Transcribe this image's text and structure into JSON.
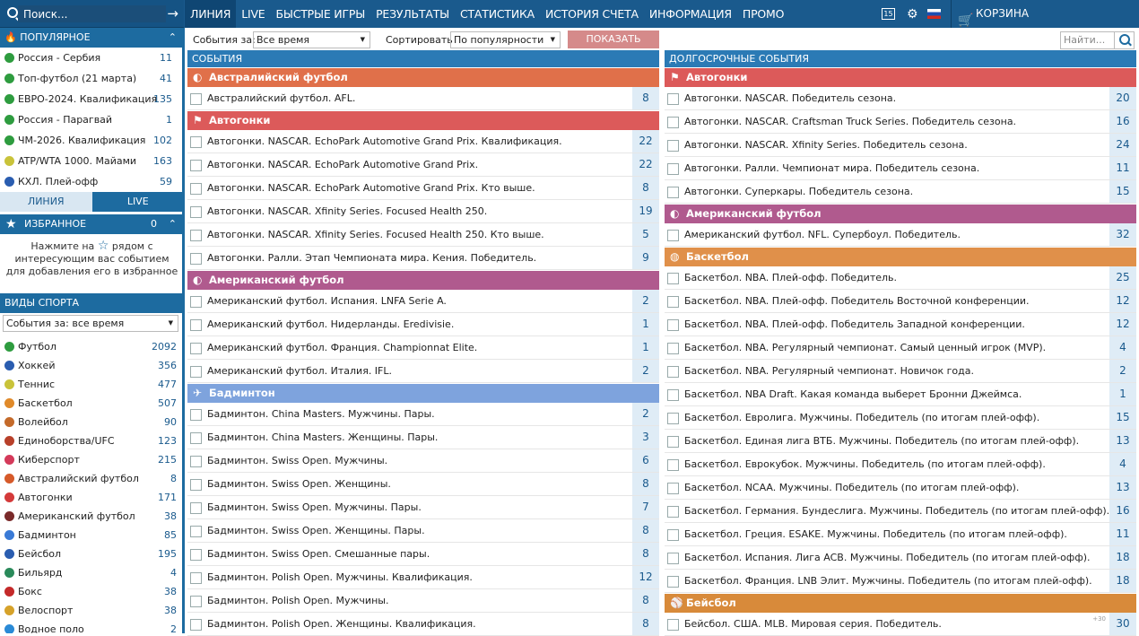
{
  "search": {
    "placeholder": "Поиск...",
    "arrow": "→"
  },
  "nav": [
    "ЛИНИЯ",
    "LIVE",
    "БЫСТРЫЕ ИГРЫ",
    "РЕЗУЛЬТАТЫ",
    "СТАТИСТИКА",
    "ИСТОРИЯ СЧЕТА",
    "ИНФОРМАЦИЯ",
    "ПРОМО"
  ],
  "topright": {
    "badge": "15",
    "cart": "КОРЗИНА"
  },
  "sidebar": {
    "popular_title": "ПОПУЛЯРНОЕ",
    "popular": [
      {
        "label": "Россия - Сербия",
        "n": "11",
        "color": "#2e9c3f"
      },
      {
        "label": "Топ-футбол (21 марта)",
        "n": "41",
        "color": "#2e9c3f"
      },
      {
        "label": "ЕВРО-2024. Квалификация",
        "n": "135",
        "color": "#2e9c3f"
      },
      {
        "label": "Россия - Парагвай",
        "n": "1",
        "color": "#2e9c3f"
      },
      {
        "label": "ЧМ-2026. Квалификация",
        "n": "102",
        "color": "#2e9c3f"
      },
      {
        "label": "ATP/WTA 1000. Майами",
        "n": "163",
        "color": "#c9c33a"
      },
      {
        "label": "КХЛ. Плей-офф",
        "n": "59",
        "color": "#2a5db0"
      }
    ],
    "tab_line": "ЛИНИЯ",
    "tab_live": "LIVE",
    "fav_title": "ИЗБРАННОЕ",
    "fav_count": "0",
    "fav_text1": "Нажмите на",
    "fav_text2": "рядом с интересующим вас событием для добавления его в избранное",
    "sports_title": "ВИДЫ СПОРТА",
    "sports_filter": "События за: все время",
    "sports": [
      {
        "label": "Футбол",
        "n": "2092",
        "color": "#2e9c3f"
      },
      {
        "label": "Хоккей",
        "n": "356",
        "color": "#2a5db0"
      },
      {
        "label": "Теннис",
        "n": "477",
        "color": "#c9c33a"
      },
      {
        "label": "Баскетбол",
        "n": "507",
        "color": "#e08a2a"
      },
      {
        "label": "Волейбол",
        "n": "90",
        "color": "#c46a2a"
      },
      {
        "label": "Единоборства/UFC",
        "n": "123",
        "color": "#b8402a"
      },
      {
        "label": "Киберспорт",
        "n": "215",
        "color": "#d43a5a"
      },
      {
        "label": "Австралийский футбол",
        "n": "8",
        "color": "#d65a2a"
      },
      {
        "label": "Автогонки",
        "n": "171",
        "color": "#d43a3a"
      },
      {
        "label": "Американский футбол",
        "n": "38",
        "color": "#7a2a2a"
      },
      {
        "label": "Бадминтон",
        "n": "85",
        "color": "#3a7ad6"
      },
      {
        "label": "Бейсбол",
        "n": "195",
        "color": "#2a5db0"
      },
      {
        "label": "Бильярд",
        "n": "4",
        "color": "#2a8a5a"
      },
      {
        "label": "Бокс",
        "n": "38",
        "color": "#c42a2a"
      },
      {
        "label": "Велоспорт",
        "n": "38",
        "color": "#d6a22a"
      },
      {
        "label": "Водное поло",
        "n": "2",
        "color": "#2a8ad6"
      }
    ]
  },
  "filter": {
    "events_label": "События за:",
    "events_value": "Все время",
    "sort_label": "Сортировать",
    "sort_value": "По популярности",
    "show": "ПОКАЗАТЬ",
    "search_placeholder": "Найти..."
  },
  "left": {
    "title": "СОБЫТИЯ",
    "groups": [
      {
        "name": "Австралийский футбол",
        "color": "#e0704a",
        "icon": "◐",
        "rows": [
          {
            "t": "Австралийский футбол. AFL.",
            "n": "8"
          }
        ]
      },
      {
        "name": "Автогонки",
        "color": "#dc5a5a",
        "icon": "⚑",
        "rows": [
          {
            "t": "Автогонки. NASCAR. EchoPark Automotive Grand Prix. Квалификация.",
            "n": "22"
          },
          {
            "t": "Автогонки. NASCAR. EchoPark Automotive Grand Prix.",
            "n": "22"
          },
          {
            "t": "Автогонки. NASCAR. EchoPark Automotive Grand Prix. Кто выше.",
            "n": "8"
          },
          {
            "t": "Автогонки. NASCAR. Xfinity Series. Focused Health 250.",
            "n": "19"
          },
          {
            "t": "Автогонки. NASCAR. Xfinity Series. Focused Health 250. Кто выше.",
            "n": "5"
          },
          {
            "t": "Автогонки. Ралли. Этап Чемпионата мира. Кения. Победитель.",
            "n": "9"
          }
        ]
      },
      {
        "name": "Американский футбол",
        "color": "#b05a8e",
        "icon": "◐",
        "rows": [
          {
            "t": "Американский футбол. Испания. LNFA Serie A.",
            "n": "2"
          },
          {
            "t": "Американский футбол. Нидерланды. Eredivisie.",
            "n": "1"
          },
          {
            "t": "Американский футбол. Франция. Championnat Elite.",
            "n": "1"
          },
          {
            "t": "Американский футбол. Италия. IFL.",
            "n": "2"
          }
        ]
      },
      {
        "name": "Бадминтон",
        "color": "#7ea3dd",
        "icon": "✈",
        "rows": [
          {
            "t": "Бадминтон. China Masters. Мужчины. Пары.",
            "n": "2"
          },
          {
            "t": "Бадминтон. China Masters. Женщины. Пары.",
            "n": "3"
          },
          {
            "t": "Бадминтон. Swiss Open. Мужчины.",
            "n": "6"
          },
          {
            "t": "Бадминтон. Swiss Open. Женщины.",
            "n": "8"
          },
          {
            "t": "Бадминтон. Swiss Open. Мужчины. Пары.",
            "n": "7"
          },
          {
            "t": "Бадминтон. Swiss Open. Женщины. Пары.",
            "n": "8"
          },
          {
            "t": "Бадминтон. Swiss Open. Смешанные пары.",
            "n": "8"
          },
          {
            "t": "Бадминтон. Polish Open. Мужчины. Квалификация.",
            "n": "12"
          },
          {
            "t": "Бадминтон. Polish Open. Мужчины.",
            "n": "8"
          },
          {
            "t": "Бадминтон. Polish Open. Женщины. Квалификация.",
            "n": "8"
          }
        ]
      }
    ]
  },
  "right": {
    "title": "ДОЛГОСРОЧНЫЕ СОБЫТИЯ",
    "groups": [
      {
        "name": "Автогонки",
        "color": "#dc5a5a",
        "icon": "⚑",
        "rows": [
          {
            "t": "Автогонки. NASCAR. Победитель сезона.",
            "n": "20"
          },
          {
            "t": "Автогонки. NASCAR. Craftsman Truck Series. Победитель сезона.",
            "n": "16"
          },
          {
            "t": "Автогонки. NASCAR. Xfinity Series. Победитель сезона.",
            "n": "24"
          },
          {
            "t": "Автогонки. Ралли. Чемпионат мира. Победитель сезона.",
            "n": "11"
          },
          {
            "t": "Автогонки. Суперкары. Победитель сезона.",
            "n": "15"
          }
        ]
      },
      {
        "name": "Американский футбол",
        "color": "#b05a8e",
        "icon": "◐",
        "rows": [
          {
            "t": "Американский футбол. NFL. Супербоул. Победитель.",
            "n": "32"
          }
        ]
      },
      {
        "name": "Баскетбол",
        "color": "#e0904a",
        "icon": "◍",
        "rows": [
          {
            "t": "Баскетбол. NBA. Плей-офф. Победитель.",
            "n": "25"
          },
          {
            "t": "Баскетбол. NBA. Плей-офф. Победитель Восточной конференции.",
            "n": "12"
          },
          {
            "t": "Баскетбол. NBA. Плей-офф. Победитель Западной конференции.",
            "n": "12"
          },
          {
            "t": "Баскетбол. NBA. Регулярный чемпионат. Самый ценный игрок (MVP).",
            "n": "4"
          },
          {
            "t": "Баскетбол. NBA. Регулярный чемпионат. Новичок года.",
            "n": "2"
          },
          {
            "t": "Баскетбол. NBA Draft. Какая команда выберет Бронни Джеймса.",
            "n": "1"
          },
          {
            "t": "Баскетбол. Евролига. Мужчины. Победитель (по итогам плей-офф).",
            "n": "15"
          },
          {
            "t": "Баскетбол. Единая лига ВТБ. Мужчины. Победитель (по итогам плей-офф).",
            "n": "13"
          },
          {
            "t": "Баскетбол. Еврокубок. Мужчины. Победитель (по итогам плей-офф).",
            "n": "4"
          },
          {
            "t": "Баскетбол. NCAA. Мужчины. Победитель (по итогам плей-офф).",
            "n": "13"
          },
          {
            "t": "Баскетбол. Германия. Бундеслига. Мужчины. Победитель (по итогам плей-офф).",
            "n": "16"
          },
          {
            "t": "Баскетбол. Греция. ESAKE. Мужчины. Победитель (по итогам плей-офф).",
            "n": "11"
          },
          {
            "t": "Баскетбол. Испания. Лига ACB. Мужчины. Победитель (по итогам плей-офф).",
            "n": "18"
          },
          {
            "t": "Баскетбол. Франция. LNB Элит. Мужчины. Победитель (по итогам плей-офф).",
            "n": "18"
          }
        ]
      },
      {
        "name": "Бейсбол",
        "color": "#d88a3a",
        "icon": "⚾",
        "rows": [
          {
            "t": "Бейсбол. США. MLB. Мировая серия. Победитель.",
            "n": "30",
            "small": "+30"
          }
        ]
      }
    ]
  }
}
